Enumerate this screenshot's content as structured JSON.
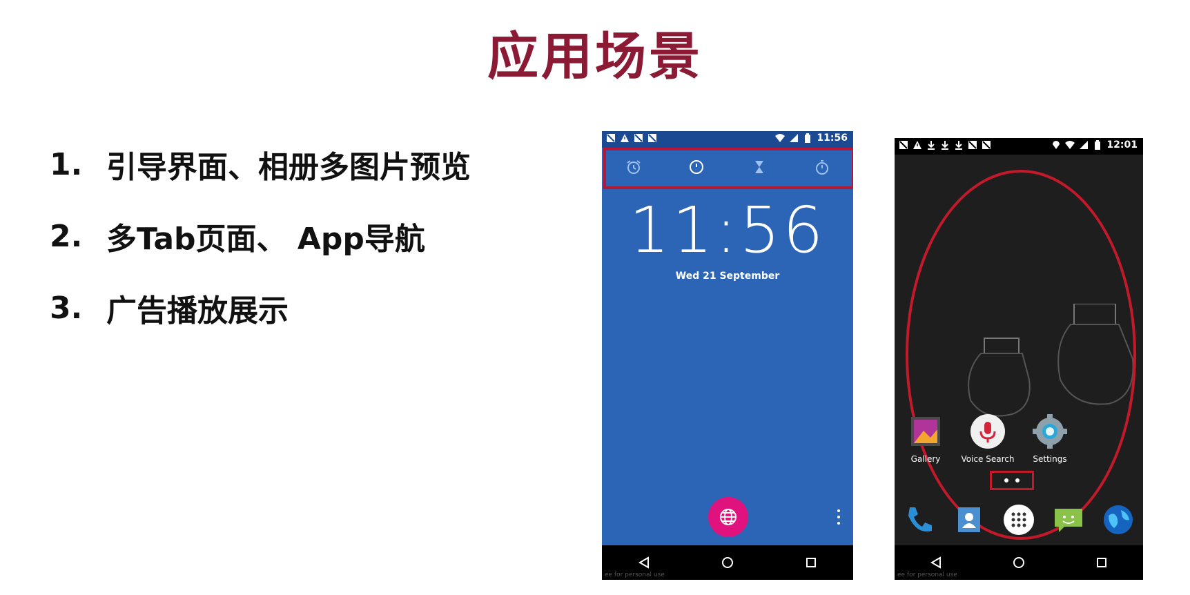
{
  "slide": {
    "title": "应用场景",
    "bullets": [
      {
        "num": "1.",
        "text": "引导界面、相册多图片预览"
      },
      {
        "num": "2.",
        "text": "多Tab页面、 App导航"
      },
      {
        "num": "3.",
        "text": "广告播放展示"
      }
    ]
  },
  "phone1": {
    "status_time": "11:56",
    "tabs": [
      "alarm-icon",
      "clock-icon",
      "timer-icon",
      "stopwatch-icon"
    ],
    "clock": "11:56",
    "date": "Wed 21 September",
    "watermark": "ee for personal use"
  },
  "phone2": {
    "status_time": "12:01",
    "apps": [
      {
        "label": "Gallery",
        "icon": "gallery-icon"
      },
      {
        "label": "Voice Search",
        "icon": "microphone-icon"
      },
      {
        "label": "Settings",
        "icon": "gear-icon"
      }
    ],
    "dock": [
      "phone-icon",
      "contacts-icon",
      "app-drawer-icon",
      "messaging-icon",
      "browser-icon"
    ],
    "watermark": "ee for personal use"
  },
  "colors": {
    "title": "#8b1a35",
    "highlight_red": "#b3173a",
    "clock_blue": "#2c65b6",
    "fab_pink": "#e0137e"
  }
}
